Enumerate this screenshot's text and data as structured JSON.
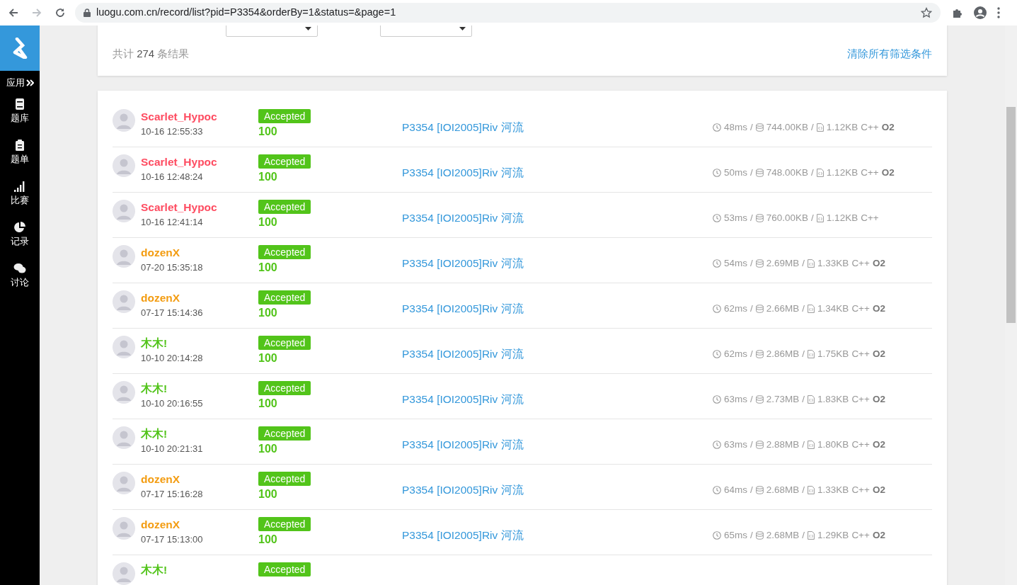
{
  "browser": {
    "url": "luogu.com.cn/record/list?pid=P3354&orderBy=1&status=&page=1"
  },
  "sidebar": {
    "apps_label": "应用",
    "items": [
      {
        "kind": "book",
        "label": "题库"
      },
      {
        "kind": "clipboard",
        "label": "题单"
      },
      {
        "kind": "bars",
        "label": "比赛"
      },
      {
        "kind": "pie",
        "label": "记录"
      },
      {
        "kind": "chat",
        "label": "讨论"
      }
    ]
  },
  "filters": {
    "count_prefix": "共计",
    "count": "274",
    "count_suffix": "条结果",
    "clear_link": "清除所有筛选条件"
  },
  "stat_separator": "/",
  "records": [
    {
      "user": "Scarlet_Hypoc",
      "color": "#fe4c61",
      "time": "10-16 12:55:33",
      "status": "Accepted",
      "score": "100",
      "problem": "P3354 [IOI2005]Riv 河流",
      "runtime": "48ms",
      "memory": "744.00KB",
      "code_size": "1.12KB",
      "language": "C++",
      "o2": "O2"
    },
    {
      "user": "Scarlet_Hypoc",
      "color": "#fe4c61",
      "time": "10-16 12:48:24",
      "status": "Accepted",
      "score": "100",
      "problem": "P3354 [IOI2005]Riv 河流",
      "runtime": "50ms",
      "memory": "748.00KB",
      "code_size": "1.12KB",
      "language": "C++",
      "o2": "O2"
    },
    {
      "user": "Scarlet_Hypoc",
      "color": "#fe4c61",
      "time": "10-16 12:41:14",
      "status": "Accepted",
      "score": "100",
      "problem": "P3354 [IOI2005]Riv 河流",
      "runtime": "53ms",
      "memory": "760.00KB",
      "code_size": "1.12KB",
      "language": "C++"
    },
    {
      "user": "dozenX",
      "color": "#f39c11",
      "time": "07-20 15:35:18",
      "status": "Accepted",
      "score": "100",
      "problem": "P3354 [IOI2005]Riv 河流",
      "runtime": "54ms",
      "memory": "2.69MB",
      "code_size": "1.33KB",
      "language": "C++",
      "o2": "O2"
    },
    {
      "user": "dozenX",
      "color": "#f39c11",
      "time": "07-17 15:14:36",
      "status": "Accepted",
      "score": "100",
      "problem": "P3354 [IOI2005]Riv 河流",
      "runtime": "62ms",
      "memory": "2.66MB",
      "code_size": "1.34KB",
      "language": "C++",
      "o2": "O2"
    },
    {
      "user": "木木!",
      "color": "#52c41a",
      "time": "10-10 20:14:28",
      "status": "Accepted",
      "score": "100",
      "problem": "P3354 [IOI2005]Riv 河流",
      "runtime": "62ms",
      "memory": "2.86MB",
      "code_size": "1.75KB",
      "language": "C++",
      "o2": "O2"
    },
    {
      "user": "木木!",
      "color": "#52c41a",
      "time": "10-10 20:16:55",
      "status": "Accepted",
      "score": "100",
      "problem": "P3354 [IOI2005]Riv 河流",
      "runtime": "63ms",
      "memory": "2.73MB",
      "code_size": "1.83KB",
      "language": "C++",
      "o2": "O2"
    },
    {
      "user": "木木!",
      "color": "#52c41a",
      "time": "10-10 20:21:31",
      "status": "Accepted",
      "score": "100",
      "problem": "P3354 [IOI2005]Riv 河流",
      "runtime": "63ms",
      "memory": "2.88MB",
      "code_size": "1.80KB",
      "language": "C++",
      "o2": "O2"
    },
    {
      "user": "dozenX",
      "color": "#f39c11",
      "time": "07-17 15:16:28",
      "status": "Accepted",
      "score": "100",
      "problem": "P3354 [IOI2005]Riv 河流",
      "runtime": "64ms",
      "memory": "2.68MB",
      "code_size": "1.33KB",
      "language": "C++",
      "o2": "O2"
    },
    {
      "user": "dozenX",
      "color": "#f39c11",
      "time": "07-17 15:13:00",
      "status": "Accepted",
      "score": "100",
      "problem": "P3354 [IOI2005]Riv 河流",
      "runtime": "65ms",
      "memory": "2.68MB",
      "code_size": "1.29KB",
      "language": "C++",
      "o2": "O2"
    },
    {
      "user": "木木!",
      "color": "#52c41a",
      "status": "Accepted"
    }
  ]
}
